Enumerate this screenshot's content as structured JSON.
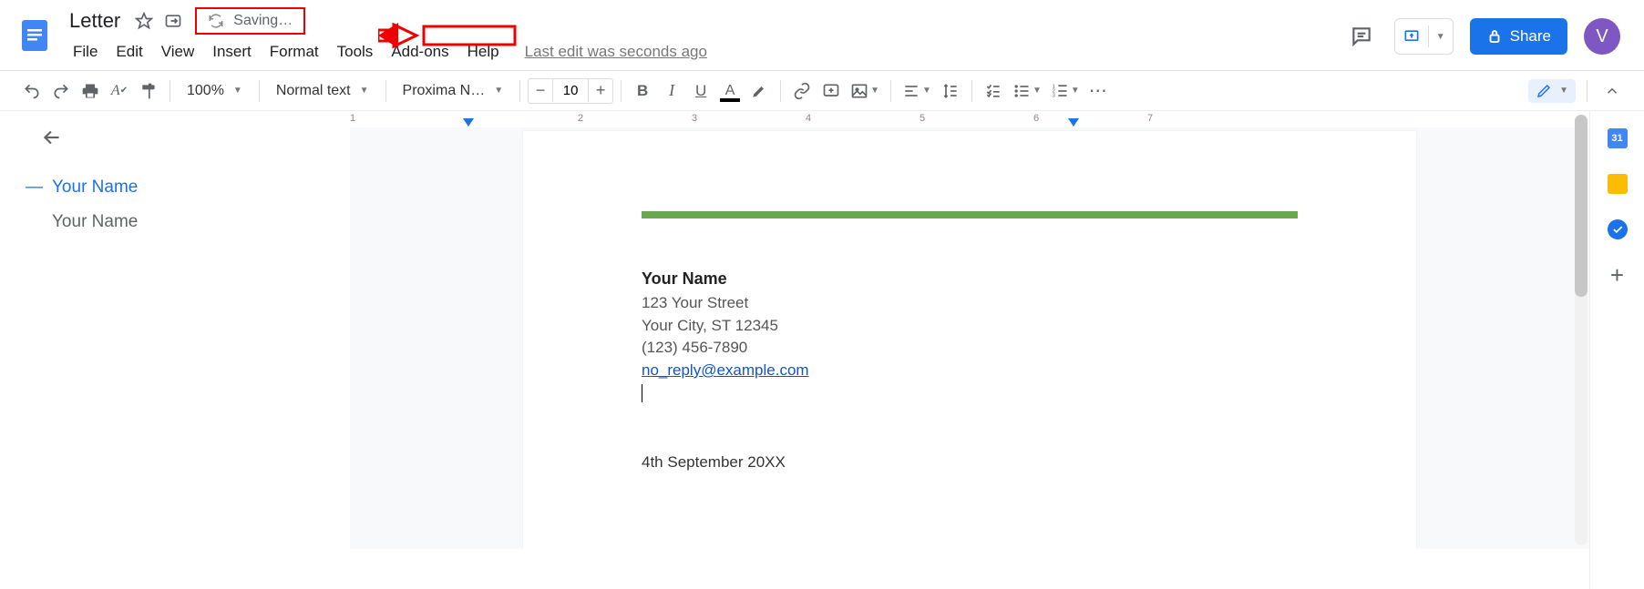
{
  "header": {
    "doc_title": "Letter",
    "saving_text": "Saving…",
    "last_edit": "Last edit was seconds ago",
    "share_label": "Share",
    "avatar_letter": "V"
  },
  "menu": {
    "file": "File",
    "edit": "Edit",
    "view": "View",
    "insert": "Insert",
    "format": "Format",
    "tools": "Tools",
    "addons": "Add-ons",
    "help": "Help"
  },
  "toolbar": {
    "zoom": "100%",
    "style": "Normal text",
    "font": "Proxima N…",
    "font_size": "10"
  },
  "outline": {
    "items": [
      {
        "label": "Your Name",
        "active": true
      },
      {
        "label": "Your Name",
        "active": false
      }
    ]
  },
  "document": {
    "name": "Your Name",
    "street": "123 Your Street",
    "city": "Your City, ST 12345",
    "phone": "(123) 456-7890",
    "email": "no_reply@example.com",
    "date": "4th September 20XX"
  },
  "ruler": {
    "numbers": [
      "1",
      "2",
      "3",
      "4",
      "5",
      "6",
      "7"
    ]
  },
  "side": {
    "calendar_day": "31"
  }
}
